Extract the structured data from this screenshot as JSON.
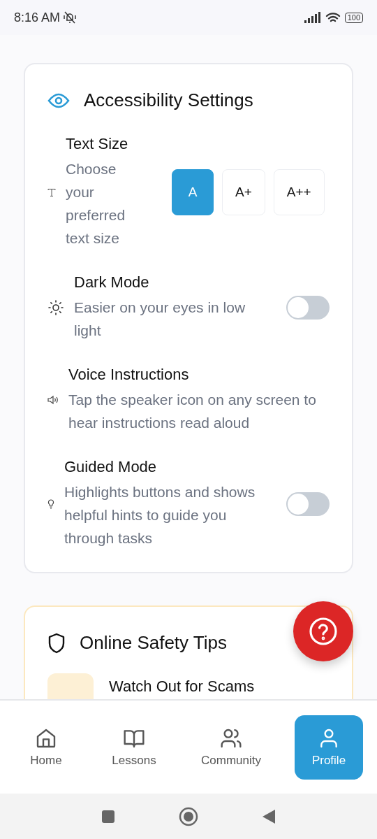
{
  "status_bar": {
    "time": "8:16 AM",
    "battery": "100"
  },
  "accessibility": {
    "title": "Accessibility Settings",
    "settings": [
      {
        "kind": "size_picker",
        "title": "Text Size",
        "description": "Choose your preferred text size",
        "options": [
          {
            "label": "A",
            "selected": true
          },
          {
            "label": "A+",
            "selected": false
          },
          {
            "label": "A++",
            "selected": false
          }
        ]
      },
      {
        "kind": "toggle",
        "title": "Dark Mode",
        "description": "Easier on your eyes in low light",
        "on": false
      },
      {
        "kind": "info",
        "title": "Voice Instructions",
        "description": "Tap the speaker icon on any screen to hear instructions read aloud"
      },
      {
        "kind": "toggle",
        "title": "Guided Mode",
        "description": "Highlights buttons and shows helpful hints to guide you through tasks",
        "on": false
      }
    ]
  },
  "safety": {
    "title": "Online Safety Tips",
    "tips": [
      {
        "title": "Watch Out for Scams"
      }
    ]
  },
  "nav": [
    {
      "label": "Home",
      "selected": false
    },
    {
      "label": "Lessons",
      "selected": false
    },
    {
      "label": "Community",
      "selected": false
    },
    {
      "label": "Profile",
      "selected": true
    }
  ]
}
